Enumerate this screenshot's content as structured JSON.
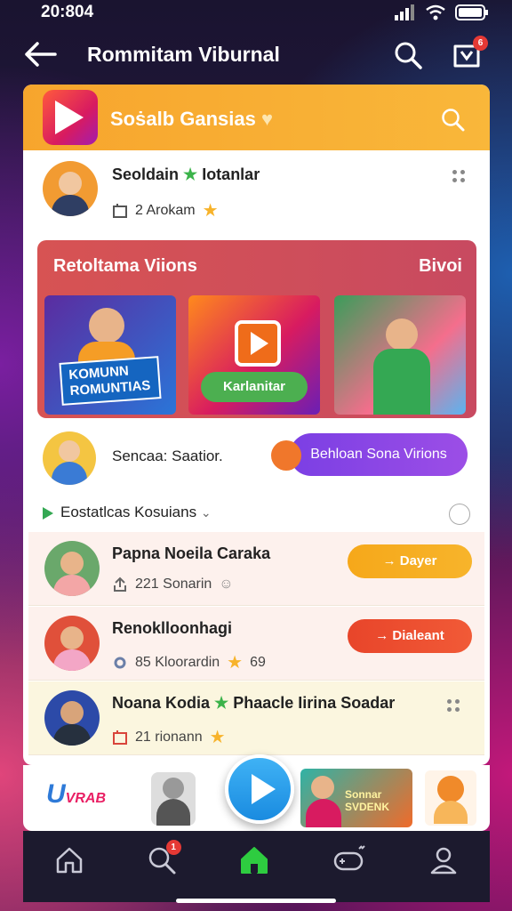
{
  "status": {
    "time": "20:804"
  },
  "topbar": {
    "title": "Rommitam Viburnal",
    "cart_badge": "6"
  },
  "panel": {
    "title_a": "Soṡalb",
    "title_b": " Gansias",
    "profile": {
      "name": "Seoldain",
      "name_suffix": "Iotanlar",
      "meta": "2 Arokam"
    }
  },
  "feature": {
    "title": "Retoltama Viions",
    "action": "Bivoi",
    "thumb1_label": "KOMUNN ROMUNTIAS",
    "thumb2_button": "Karlanitar"
  },
  "session": {
    "text": "Sencaa: Saatior.",
    "button": "Behloan Sona Virions"
  },
  "section": {
    "label": "Eostatlcas Kosuians"
  },
  "list": [
    {
      "name": "Papna Noeila Caraka",
      "meta": "221 Sonarin",
      "button": "→ Dayer"
    },
    {
      "name": "Renoklloonhagi",
      "meta": "85 Kloorardin",
      "meta2": "69",
      "button": "→ Dialeant"
    },
    {
      "name": "Noana Kodia",
      "name_suffix": "Phaacle Iirina Soadar",
      "meta": "21 rionann"
    }
  ],
  "strip": {
    "logo_text": "U",
    "logo_sub": "VRAB",
    "card_text": "Sonnar SVDENK"
  },
  "nav": {
    "notif_badge": "1",
    "active": "home"
  },
  "colors": {
    "accent": "#f7a52d",
    "purple": "#7b3fe4",
    "red": "#d75353",
    "green": "#34a853",
    "nav_bg": "#1c1a2e"
  },
  "icons": [
    "back-arrow-icon",
    "search-icon",
    "shopping-bag-icon",
    "more-dots-icon",
    "play-icon",
    "home-icon",
    "search-nav-icon",
    "home-active-icon",
    "game-controller-icon",
    "profile-icon"
  ]
}
